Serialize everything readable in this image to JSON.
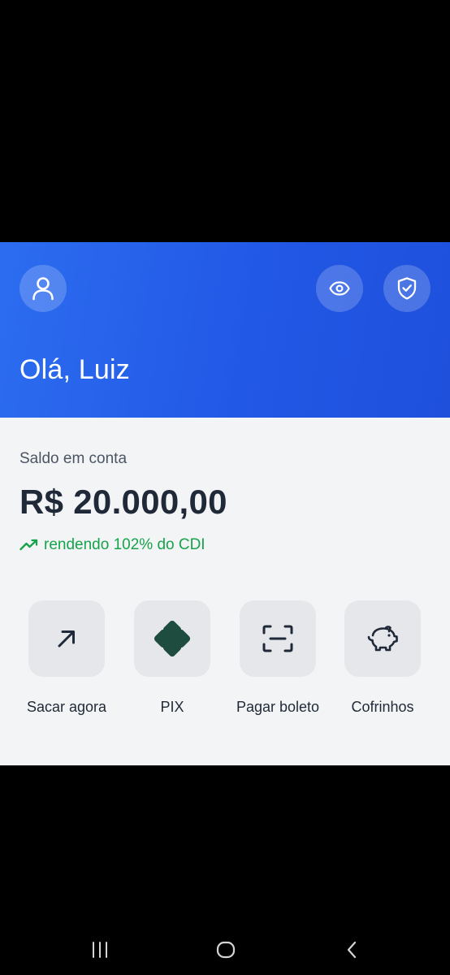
{
  "header": {
    "greeting": "Olá, Luiz",
    "gradient_start": "#2c6df0",
    "gradient_end": "#1e50dc",
    "icons": [
      "user-icon",
      "eye-icon",
      "shield-check-icon"
    ]
  },
  "balance": {
    "label": "Saldo em conta",
    "value": "R$ 20.000,00",
    "yield_text": "rendendo 102% do CDI",
    "yield_color": "#16a34a"
  },
  "actions": [
    {
      "label": "Sacar agora",
      "icon": "arrow-up-right-icon"
    },
    {
      "label": "PIX",
      "icon": "pix-icon"
    },
    {
      "label": "Pagar boleto",
      "icon": "barcode-scan-icon"
    },
    {
      "label": "Cofrinhos",
      "icon": "piggy-bank-icon"
    }
  ],
  "system_nav": {
    "icons": [
      "recents-icon",
      "home-icon",
      "back-icon"
    ]
  }
}
